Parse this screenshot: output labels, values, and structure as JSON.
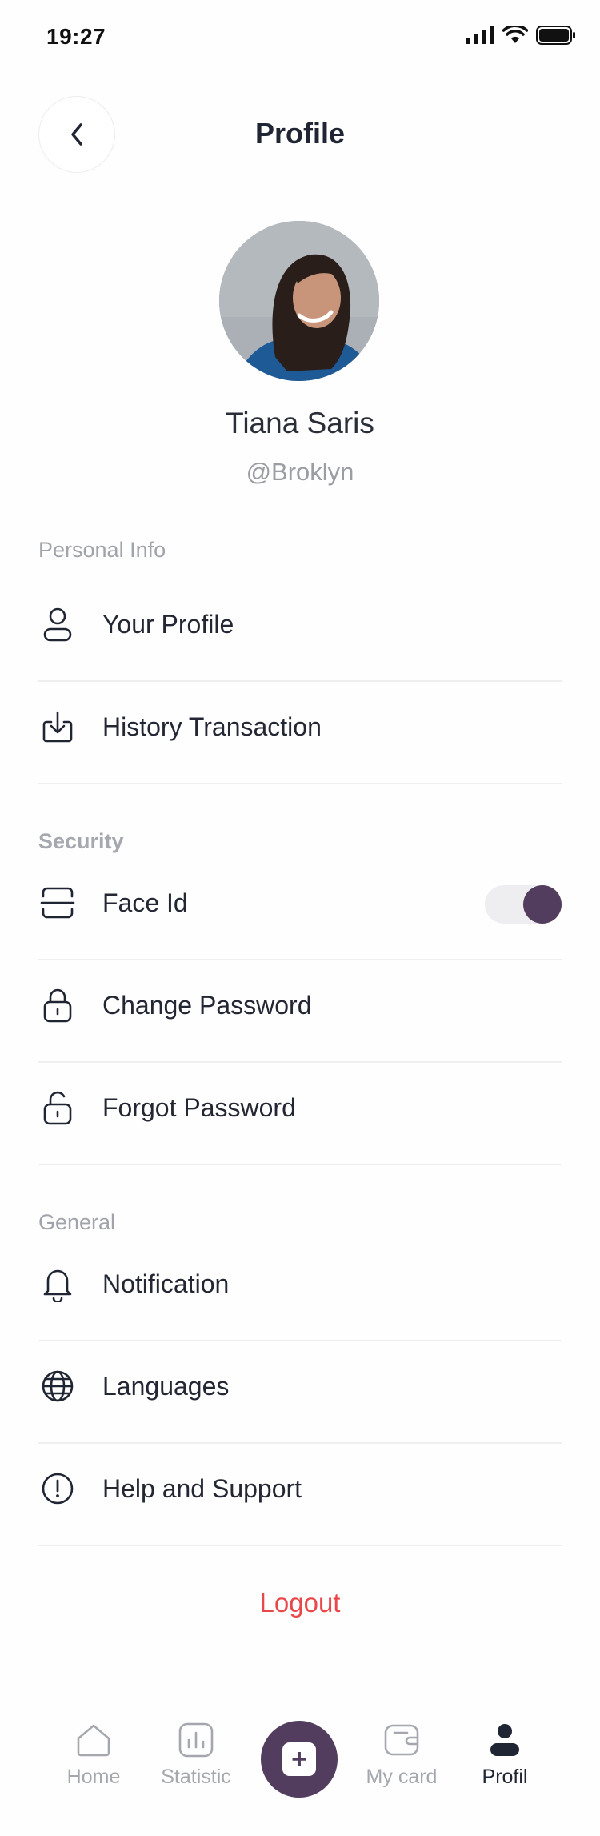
{
  "status_bar": {
    "time": "19:27"
  },
  "header": {
    "title": "Profile"
  },
  "user": {
    "name": "Tiana Saris",
    "handle": "@Broklyn"
  },
  "sections": {
    "personal": {
      "label": "Personal Info",
      "items": [
        {
          "label": "Your Profile",
          "icon": "user-icon"
        },
        {
          "label": "History Transaction",
          "icon": "download-icon"
        }
      ]
    },
    "security": {
      "label": "Security",
      "items": [
        {
          "label": "Face Id",
          "icon": "face-id-icon",
          "toggle_on": true
        },
        {
          "label": "Change Password",
          "icon": "lock-icon"
        },
        {
          "label": "Forgot Password",
          "icon": "unlock-icon"
        }
      ]
    },
    "general": {
      "label": "General",
      "items": [
        {
          "label": "Notification",
          "icon": "bell-icon"
        },
        {
          "label": "Languages",
          "icon": "globe-icon"
        },
        {
          "label": "Help and Support",
          "icon": "info-icon"
        }
      ]
    }
  },
  "logout_label": "Logout",
  "nav": {
    "items": [
      {
        "label": "Home",
        "icon": "home-icon",
        "active": false
      },
      {
        "label": "Statistic",
        "icon": "chart-icon",
        "active": false
      },
      {
        "label": "My card",
        "icon": "wallet-icon",
        "active": false
      },
      {
        "label": "Profil",
        "icon": "person-icon",
        "active": true
      }
    ],
    "fab_icon": "plus-icon"
  },
  "colors": {
    "accent": "#533d5e",
    "danger": "#e9484b",
    "text": "#1f2533",
    "muted": "#a0a3aa"
  }
}
